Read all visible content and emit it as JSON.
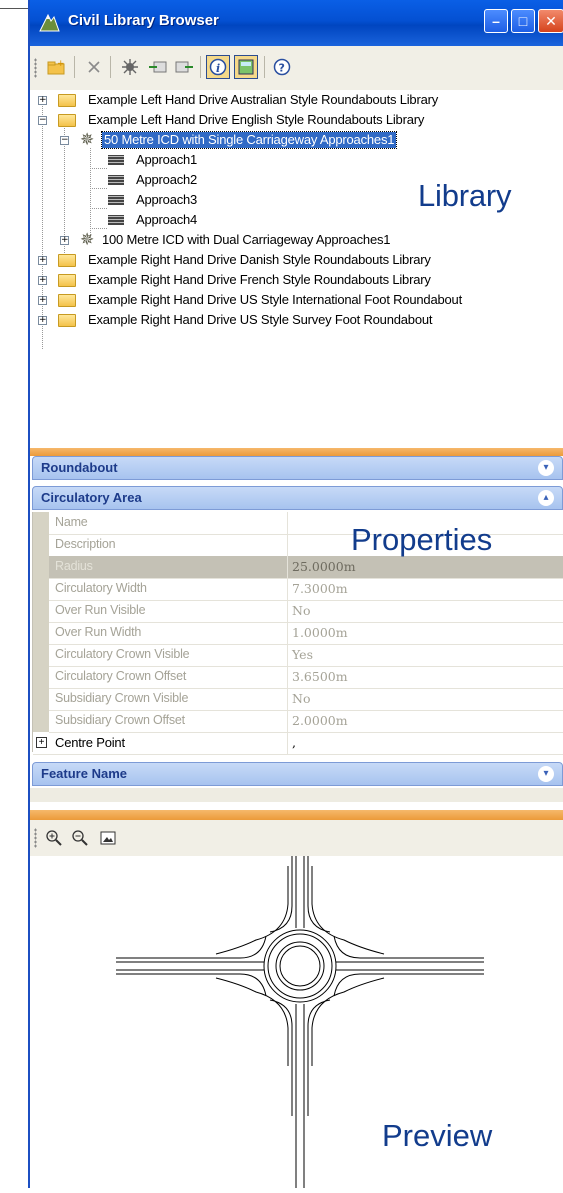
{
  "window": {
    "title": "Civil Library Browser",
    "minimize_glyph": "–",
    "maximize_glyph": "□",
    "close_glyph": "✕"
  },
  "toolbar": {
    "icons": [
      "new-folder-icon",
      "delete-icon",
      "add-item-icon",
      "import-icon",
      "export-icon",
      "info-icon",
      "properties-pane-icon",
      "help-icon"
    ]
  },
  "tree": {
    "items": [
      {
        "label": "Example Left Hand Drive Australian Style Roundabouts Library",
        "icon": "folder-icon",
        "expander": "+"
      },
      {
        "label": "Example Left Hand Drive English Style Roundabouts Library",
        "icon": "folder-icon",
        "expander": "−"
      },
      {
        "label": "50 Metre ICD with Single Carriageway Approaches1",
        "icon": "roundabout-icon",
        "expander": "−"
      },
      {
        "label": "Approach1",
        "icon": "approach-icon"
      },
      {
        "label": "Approach2",
        "icon": "approach-icon"
      },
      {
        "label": "Approach3",
        "icon": "approach-icon"
      },
      {
        "label": "Approach4",
        "icon": "approach-icon"
      },
      {
        "label": "100 Metre ICD with Dual Carriageway Approaches1",
        "icon": "roundabout-icon",
        "expander": "+"
      },
      {
        "label": "Example Right Hand Drive Danish Style Roundabouts Library",
        "icon": "folder-icon",
        "expander": "+"
      },
      {
        "label": "Example Right Hand Drive French Style Roundabouts Library",
        "icon": "folder-icon",
        "expander": "+"
      },
      {
        "label": "Example Right Hand Drive US Style International Foot Roundabout",
        "icon": "folder-icon",
        "expander": "+"
      },
      {
        "label": "Example Right Hand Drive US Style Survey Foot Roundabout",
        "icon": "folder-icon",
        "expander": "+"
      }
    ]
  },
  "annotations": {
    "library": "Library",
    "properties": "Properties",
    "preview": "Preview"
  },
  "sections": {
    "roundabout": "Roundabout",
    "circulatory_area": "Circulatory Area",
    "feature_name": "Feature Name",
    "collapse_glyph": "»",
    "expand_glyph": "«"
  },
  "properties": {
    "rows": [
      {
        "name": "Name",
        "value": ""
      },
      {
        "name": "Description",
        "value": ""
      },
      {
        "name": "Radius",
        "value": "25.0000m"
      },
      {
        "name": "Circulatory Width",
        "value": "7.3000m"
      },
      {
        "name": "Over Run Visible",
        "value": "No"
      },
      {
        "name": "Over Run Width",
        "value": "1.0000m"
      },
      {
        "name": "Circulatory Crown Visible",
        "value": "Yes"
      },
      {
        "name": "Circulatory Crown Offset",
        "value": "3.6500m"
      },
      {
        "name": "Subsidiary Crown Visible",
        "value": "No"
      },
      {
        "name": "Subsidiary Crown Offset",
        "value": "2.0000m"
      },
      {
        "name": "Centre Point",
        "value": ","
      }
    ]
  },
  "preview_toolbar": {
    "icons": [
      "zoom-in-icon",
      "zoom-out-icon",
      "zoom-extents-icon"
    ]
  },
  "colors": {
    "titlebar": "#0450d2",
    "selection": "#316ac5",
    "splitter": "#ec9a3a",
    "section_header": "#b7cff3"
  }
}
